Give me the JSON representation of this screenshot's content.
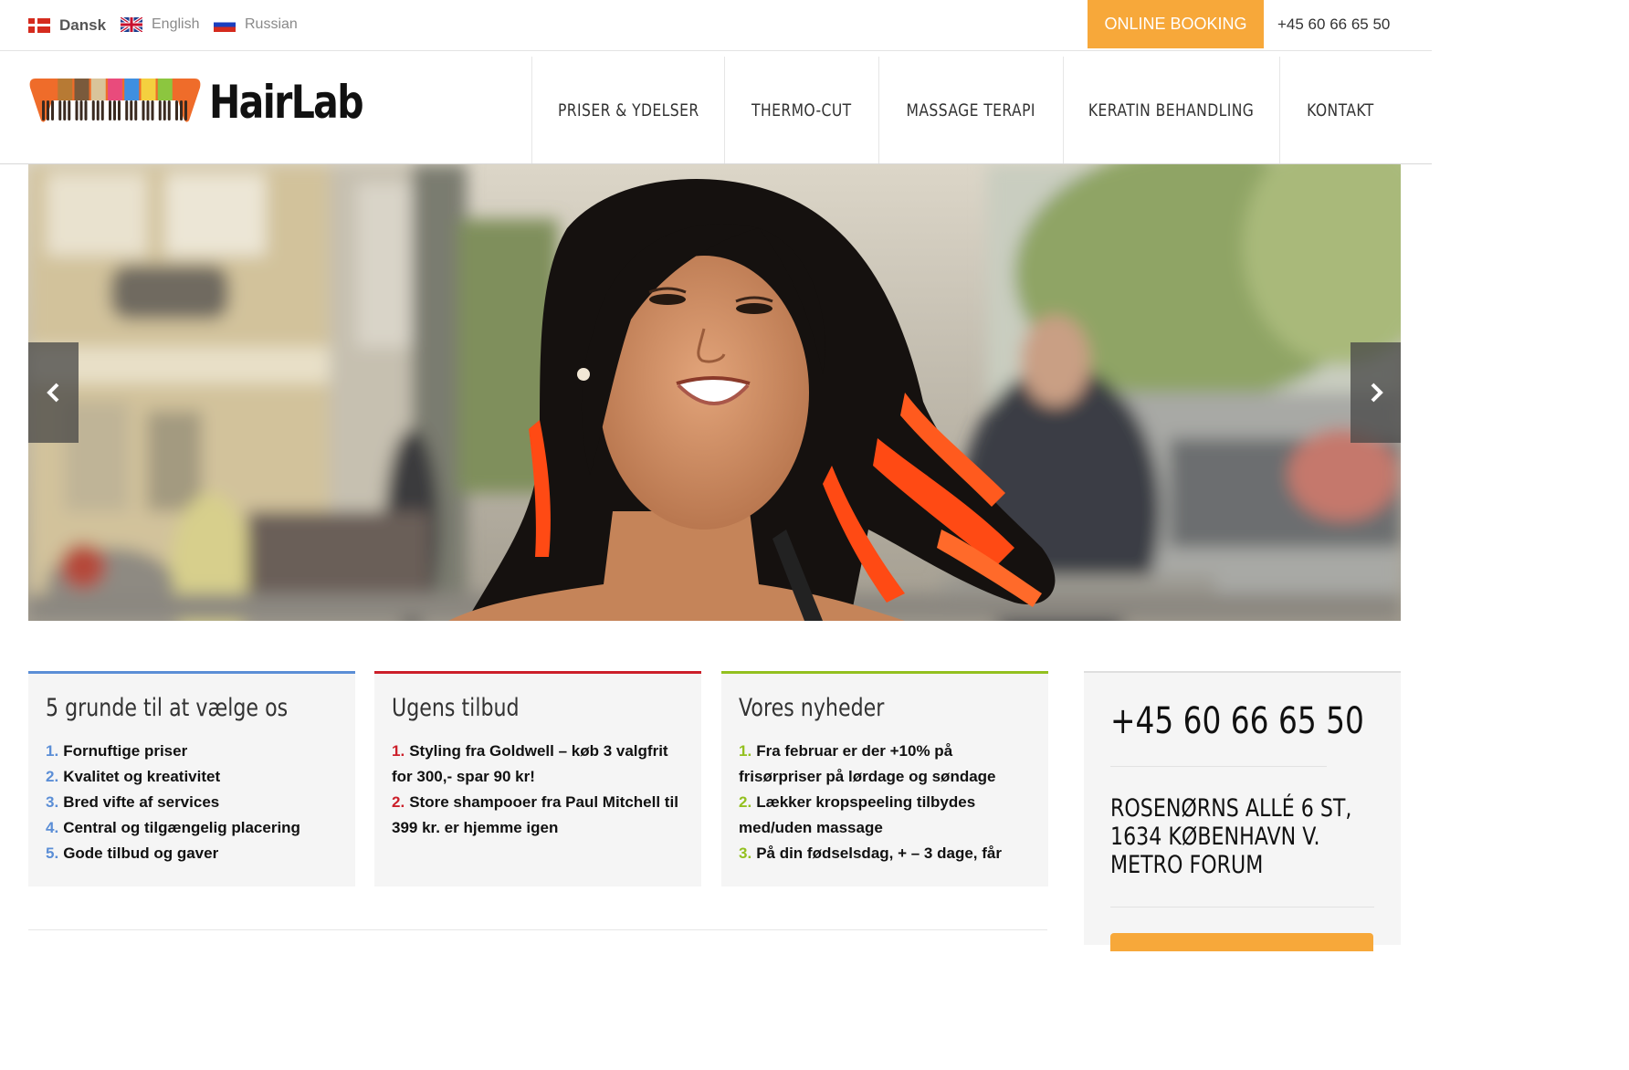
{
  "languages": [
    {
      "label": "Dansk",
      "flag": "denmark-flag-icon"
    },
    {
      "label": "English",
      "flag": "uk-flag-icon"
    },
    {
      "label": "Russian",
      "flag": "russia-flag-icon"
    }
  ],
  "topbar": {
    "booking_label": "ONLINE BOOKING",
    "phone": "+45 60 66 65 50"
  },
  "brand": {
    "name": "HairLab",
    "comb_colors": [
      "#ef6c2a",
      "#b77a34",
      "#7a5a3c",
      "#d9c49a",
      "#e94b7c",
      "#3f8fe0",
      "#f4d03f",
      "#8cc63f",
      "#ef6c2a"
    ]
  },
  "nav": [
    {
      "label": "PRISER & YDELSER"
    },
    {
      "label": "THERMO-CUT"
    },
    {
      "label": "MASSAGE TERAPI"
    },
    {
      "label": "KERATIN BEHANDLING"
    },
    {
      "label": "KONTAKT"
    }
  ],
  "slider": {
    "prev_icon": "chevron-left-icon",
    "next_icon": "chevron-right-icon"
  },
  "boxes": [
    {
      "title": "5 grunde til at vælge os",
      "accent": "#5b8ed6",
      "items": [
        {
          "num": "1.",
          "text": "Fornuftige priser"
        },
        {
          "num": "2.",
          "text": "Kvalitet og kreativitet"
        },
        {
          "num": "3.",
          "text": "Bred vifte af services"
        },
        {
          "num": "4.",
          "text": "Central og tilgængelig placering"
        },
        {
          "num": "5.",
          "text": "Gode tilbud og gaver"
        }
      ]
    },
    {
      "title": "Ugens tilbud",
      "accent": "#cc1f2a",
      "items": [
        {
          "num": "1.",
          "text": "Styling fra Goldwell – køb 3 valgfrit for 300,- spar 90 kr!"
        },
        {
          "num": "2.",
          "text": "Store shampooer fra Paul Mitchell til 399 kr. er hjemme igen"
        }
      ]
    },
    {
      "title": "Vores nyheder",
      "accent": "#93c01f",
      "items": [
        {
          "num": "1.",
          "text": "Fra februar er der +10% på frisørpriser på lørdage og søndage"
        },
        {
          "num": "2.",
          "text": "Lækker kropspeeling tilbydes med/uden massage"
        },
        {
          "num": "3.",
          "text": "På din fødselsdag, + – 3 dage, får"
        }
      ]
    }
  ],
  "contact": {
    "phone": "+45 60 66 65 50",
    "address": [
      "ROSENØRNS ALLÉ 6 ST,",
      "1634 KØBENHAVN V.",
      "METRO FORUM"
    ],
    "button_color": "#f7a83a"
  }
}
